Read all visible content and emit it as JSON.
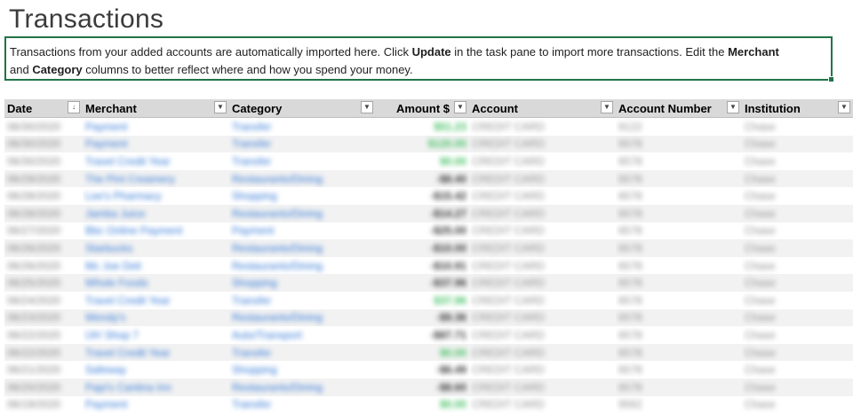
{
  "page": {
    "title": "Transactions"
  },
  "info": {
    "text_1": "Transactions from your added accounts are automatically imported here. Click ",
    "bold_1": "Update",
    "text_2": " in the task pane to import more transactions. Edit the ",
    "bold_2": "Merchant",
    "text_3": "and ",
    "bold_3": "Category",
    "text_4": " columns to better reflect where and how you spend your money."
  },
  "table": {
    "headers": {
      "date": "Date",
      "merchant": "Merchant",
      "category": "Category",
      "amount": "Amount $",
      "account": "Account",
      "account_number": "Account Number",
      "institution": "Institution"
    },
    "date_sort_icon": "↓",
    "filter_icon": "▼",
    "rows": [
      {
        "date": "06/30/2020",
        "merchant": "Payment",
        "category": "Transfer",
        "amount": "$51.23",
        "positive": true,
        "account": "CREDIT CARD",
        "account_number": "9122",
        "institution": "Chase"
      },
      {
        "date": "06/30/2020",
        "merchant": "Payment",
        "category": "Transfer",
        "amount": "$120.00",
        "positive": true,
        "account": "CREDIT CARD",
        "account_number": "6578",
        "institution": "Chase"
      },
      {
        "date": "06/30/2020",
        "merchant": "Travel Credit Year",
        "category": "Transfer",
        "amount": "$0.00",
        "positive": true,
        "account": "CREDIT CARD",
        "account_number": "6578",
        "institution": "Chase"
      },
      {
        "date": "06/29/2020",
        "merchant": "The Pint Creamery",
        "category": "Restaurants/Dining",
        "amount": "-$8.40",
        "positive": false,
        "account": "CREDIT CARD",
        "account_number": "6578",
        "institution": "Chase"
      },
      {
        "date": "06/28/2020",
        "merchant": "Lee's Pharmacy",
        "category": "Shopping",
        "amount": "-$15.42",
        "positive": false,
        "account": "CREDIT CARD",
        "account_number": "6578",
        "institution": "Chase"
      },
      {
        "date": "06/28/2020",
        "merchant": "Jamba Juice",
        "category": "Restaurants/Dining",
        "amount": "-$14.27",
        "positive": false,
        "account": "CREDIT CARD",
        "account_number": "6578",
        "institution": "Chase"
      },
      {
        "date": "06/27/2020",
        "merchant": "Bbc Online Payment",
        "category": "Payment",
        "amount": "-$25.00",
        "positive": false,
        "account": "CREDIT CARD",
        "account_number": "6578",
        "institution": "Chase"
      },
      {
        "date": "06/26/2020",
        "merchant": "Starbucks",
        "category": "Restaurants/Dining",
        "amount": "-$10.00",
        "positive": false,
        "account": "CREDIT CARD",
        "account_number": "6578",
        "institution": "Chase"
      },
      {
        "date": "06/26/2020",
        "merchant": "Mc Joe Deli",
        "category": "Restaurants/Dining",
        "amount": "-$10.91",
        "positive": false,
        "account": "CREDIT CARD",
        "account_number": "6578",
        "institution": "Chase"
      },
      {
        "date": "06/25/2020",
        "merchant": "Whole Foods",
        "category": "Shopping",
        "amount": "-$37.96",
        "positive": false,
        "account": "CREDIT CARD",
        "account_number": "6578",
        "institution": "Chase"
      },
      {
        "date": "06/24/2020",
        "merchant": "Travel Credit Year",
        "category": "Transfer",
        "amount": "$37.96",
        "positive": true,
        "account": "CREDIT CARD",
        "account_number": "6578",
        "institution": "Chase"
      },
      {
        "date": "06/23/2020",
        "merchant": "Wendy's",
        "category": "Restaurants/Dining",
        "amount": "-$9.36",
        "positive": false,
        "account": "CREDIT CARD",
        "account_number": "6578",
        "institution": "Chase"
      },
      {
        "date": "06/22/2020",
        "merchant": "Uh! Shop 7",
        "category": "Auto/Transport",
        "amount": "-$87.71",
        "positive": false,
        "account": "CREDIT CARD",
        "account_number": "6578",
        "institution": "Chase"
      },
      {
        "date": "06/22/2020",
        "merchant": "Travel Credit Year",
        "category": "Transfer",
        "amount": "$0.00",
        "positive": true,
        "account": "CREDIT CARD",
        "account_number": "6578",
        "institution": "Chase"
      },
      {
        "date": "06/21/2020",
        "merchant": "Safeway",
        "category": "Shopping",
        "amount": "-$6.49",
        "positive": false,
        "account": "CREDIT CARD",
        "account_number": "6578",
        "institution": "Chase"
      },
      {
        "date": "06/20/2020",
        "merchant": "Papi's Cantina Inn",
        "category": "Restaurants/Dining",
        "amount": "-$8.60",
        "positive": false,
        "account": "CREDIT CARD",
        "account_number": "6578",
        "institution": "Chase"
      },
      {
        "date": "06/19/2020",
        "merchant": "Payment",
        "category": "Transfer",
        "amount": "$0.00",
        "positive": true,
        "account": "CREDIT CARD",
        "account_number": "9562",
        "institution": "Chase"
      }
    ]
  },
  "colors": {
    "accent": "#217346",
    "link": "#2e75d6",
    "positive": "#3fbf5f",
    "header_bg": "#d9d9d9"
  }
}
